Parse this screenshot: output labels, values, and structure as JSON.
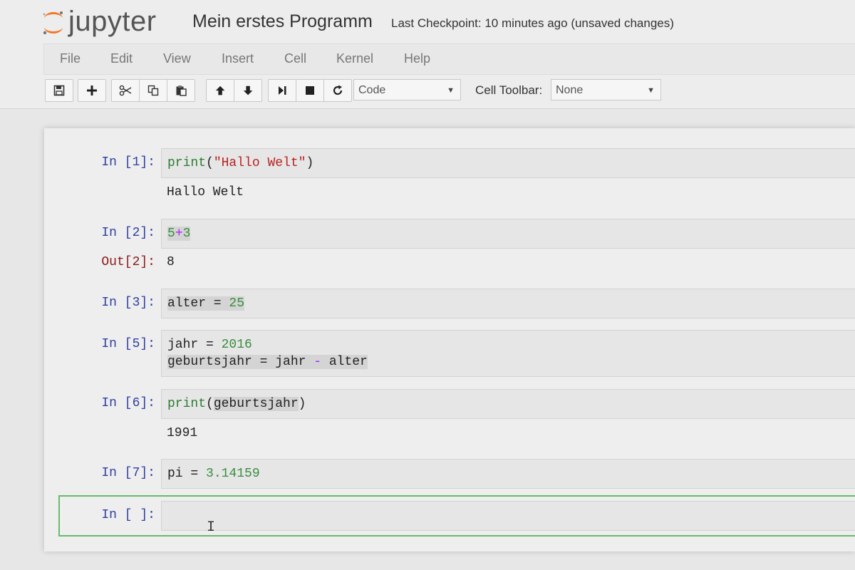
{
  "header": {
    "logo_text": "jupyter",
    "notebook_name": "Mein erstes Programm",
    "checkpoint": "Last Checkpoint: 10 minutes ago (unsaved changes)"
  },
  "menu": [
    "File",
    "Edit",
    "View",
    "Insert",
    "Cell",
    "Kernel",
    "Help"
  ],
  "toolbar": {
    "buttons": [
      "save-icon",
      "plus-icon",
      "cut-icon",
      "copy-icon",
      "paste-icon",
      "arrow-up-icon",
      "arrow-down-icon",
      "run-icon",
      "stop-icon",
      "restart-icon"
    ],
    "cell_type": "Code",
    "cell_toolbar_label": "Cell Toolbar:",
    "cell_toolbar_value": "None"
  },
  "cells": [
    {
      "prompt": "In [1]:",
      "code": [
        "print(\"Hallo Welt\")"
      ],
      "output": "Hallo Welt"
    },
    {
      "prompt": "In [2]:",
      "code": [
        "5+3"
      ],
      "out_prompt": "Out[2]:",
      "output": "8"
    },
    {
      "prompt": "In [3]:",
      "code": [
        "alter = 25"
      ]
    },
    {
      "prompt": "In [5]:",
      "code": [
        "jahr = 2016",
        "geburtsjahr = jahr - alter"
      ]
    },
    {
      "prompt": "In [6]:",
      "code": [
        "print(geburtsjahr)"
      ],
      "output": "1991"
    },
    {
      "prompt": "In [7]:",
      "code": [
        "pi = 3.14159"
      ]
    },
    {
      "prompt": "In [ ]:",
      "code": [
        ""
      ]
    }
  ],
  "colors": {
    "prompt_in": "#303f9f",
    "prompt_out": "#8b1a1a",
    "active_border": "#66bb6a",
    "keyword": "#2e7d32",
    "string": "#ba2121",
    "number": "#388e3c"
  }
}
